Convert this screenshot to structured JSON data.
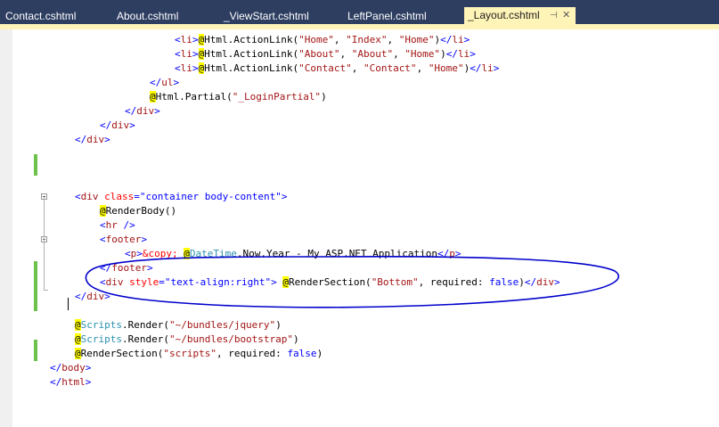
{
  "tabs": [
    {
      "label": "Contact.cshtml"
    },
    {
      "label": "About.cshtml"
    },
    {
      "label": "_ViewStart.cshtml"
    },
    {
      "label": "LeftPanel.cshtml"
    },
    {
      "label": "_Layout.cshtml",
      "active": true
    }
  ],
  "icons": {
    "pin": "pin-icon",
    "close": "close-icon",
    "fold": "fold-collapse-icon"
  },
  "colors": {
    "tabbar": "#2d3e61",
    "active_tab": "#fff4b8",
    "change_mark": "#6cc24a",
    "annotation": "#0000cc",
    "razor_at": "#ffff00"
  },
  "code_lines": [
    [
      {
        "t": "<",
        "c": "br"
      },
      {
        "t": "li",
        "c": "tag"
      },
      {
        "t": ">",
        "c": "br"
      },
      {
        "t": "@",
        "c": "at"
      },
      {
        "t": "Html.ActionLink(",
        "c": "txt"
      },
      {
        "t": "\"Home\"",
        "c": "str"
      },
      {
        "t": ", ",
        "c": "txt"
      },
      {
        "t": "\"Index\"",
        "c": "str"
      },
      {
        "t": ", ",
        "c": "txt"
      },
      {
        "t": "\"Home\"",
        "c": "str"
      },
      {
        "t": ")",
        "c": "txt"
      },
      {
        "t": "</",
        "c": "br"
      },
      {
        "t": "li",
        "c": "tag"
      },
      {
        "t": ">",
        "c": "br"
      }
    ],
    [
      {
        "t": "<",
        "c": "br"
      },
      {
        "t": "li",
        "c": "tag"
      },
      {
        "t": ">",
        "c": "br"
      },
      {
        "t": "@",
        "c": "at"
      },
      {
        "t": "Html.ActionLink(",
        "c": "txt"
      },
      {
        "t": "\"About\"",
        "c": "str"
      },
      {
        "t": ", ",
        "c": "txt"
      },
      {
        "t": "\"About\"",
        "c": "str"
      },
      {
        "t": ", ",
        "c": "txt"
      },
      {
        "t": "\"Home\"",
        "c": "str"
      },
      {
        "t": ")",
        "c": "txt"
      },
      {
        "t": "</",
        "c": "br"
      },
      {
        "t": "li",
        "c": "tag"
      },
      {
        "t": ">",
        "c": "br"
      }
    ],
    [
      {
        "t": "<",
        "c": "br"
      },
      {
        "t": "li",
        "c": "tag"
      },
      {
        "t": ">",
        "c": "br"
      },
      {
        "t": "@",
        "c": "at"
      },
      {
        "t": "Html.ActionLink(",
        "c": "txt"
      },
      {
        "t": "\"Contact\"",
        "c": "str"
      },
      {
        "t": ", ",
        "c": "txt"
      },
      {
        "t": "\"Contact\"",
        "c": "str"
      },
      {
        "t": ", ",
        "c": "txt"
      },
      {
        "t": "\"Home\"",
        "c": "str"
      },
      {
        "t": ")",
        "c": "txt"
      },
      {
        "t": "</",
        "c": "br"
      },
      {
        "t": "li",
        "c": "tag"
      },
      {
        "t": ">",
        "c": "br"
      }
    ],
    [
      {
        "t": "</",
        "c": "br"
      },
      {
        "t": "ul",
        "c": "tag"
      },
      {
        "t": ">",
        "c": "br"
      }
    ],
    [
      {
        "t": "@",
        "c": "at"
      },
      {
        "t": "Html.Partial(",
        "c": "txt"
      },
      {
        "t": "\"_LoginPartial\"",
        "c": "str"
      },
      {
        "t": ")",
        "c": "txt"
      }
    ],
    [
      {
        "t": "</",
        "c": "br"
      },
      {
        "t": "div",
        "c": "tag"
      },
      {
        "t": ">",
        "c": "br"
      }
    ],
    [
      {
        "t": "</",
        "c": "br"
      },
      {
        "t": "div",
        "c": "tag"
      },
      {
        "t": ">",
        "c": "br"
      }
    ],
    [
      {
        "t": "</",
        "c": "br"
      },
      {
        "t": "div",
        "c": "tag"
      },
      {
        "t": ">",
        "c": "br"
      }
    ],
    [],
    [],
    [],
    [],
    [
      {
        "t": "<",
        "c": "br"
      },
      {
        "t": "div",
        "c": "tag"
      },
      {
        "t": " ",
        "c": "txt"
      },
      {
        "t": "class",
        "c": "attr"
      },
      {
        "t": "=",
        "c": "br"
      },
      {
        "t": "\"container body-content\"",
        "c": "br"
      },
      {
        "t": ">",
        "c": "br"
      }
    ],
    [
      {
        "t": "@",
        "c": "at"
      },
      {
        "t": "RenderBody()",
        "c": "txt"
      }
    ],
    [
      {
        "t": "<",
        "c": "br"
      },
      {
        "t": "hr",
        "c": "tag"
      },
      {
        "t": " />",
        "c": "br"
      }
    ],
    [
      {
        "t": "<",
        "c": "br"
      },
      {
        "t": "footer",
        "c": "tag"
      },
      {
        "t": ">",
        "c": "br"
      }
    ],
    [
      {
        "t": "<",
        "c": "br"
      },
      {
        "t": "p",
        "c": "tag"
      },
      {
        "t": ">",
        "c": "br"
      },
      {
        "t": "&copy;",
        "c": "ent"
      },
      {
        "t": " ",
        "c": "txt"
      },
      {
        "t": "@",
        "c": "at"
      },
      {
        "t": "DateTime",
        "c": "type"
      },
      {
        "t": ".Now.Year - My ASP.NET Application",
        "c": "txt"
      },
      {
        "t": "</",
        "c": "br"
      },
      {
        "t": "p",
        "c": "tag"
      },
      {
        "t": ">",
        "c": "br"
      }
    ],
    [
      {
        "t": "</",
        "c": "br"
      },
      {
        "t": "footer",
        "c": "tag"
      },
      {
        "t": ">",
        "c": "br"
      }
    ],
    [
      {
        "t": "<",
        "c": "br"
      },
      {
        "t": "div",
        "c": "tag"
      },
      {
        "t": " ",
        "c": "txt"
      },
      {
        "t": "style",
        "c": "attr"
      },
      {
        "t": "=",
        "c": "br"
      },
      {
        "t": "\"text-align:right\"",
        "c": "br"
      },
      {
        "t": ">",
        "c": "br"
      },
      {
        "t": " ",
        "c": "txt"
      },
      {
        "t": "@",
        "c": "at"
      },
      {
        "t": "RenderSection(",
        "c": "txt"
      },
      {
        "t": "\"Bottom\"",
        "c": "str"
      },
      {
        "t": ", required: ",
        "c": "txt"
      },
      {
        "t": "false",
        "c": "kw"
      },
      {
        "t": ")",
        "c": "txt"
      },
      {
        "t": "</",
        "c": "br"
      },
      {
        "t": "div",
        "c": "tag"
      },
      {
        "t": ">",
        "c": "br"
      }
    ],
    [
      {
        "t": "</",
        "c": "br"
      },
      {
        "t": "div",
        "c": "tag"
      },
      {
        "t": ">",
        "c": "br"
      }
    ],
    [],
    [
      {
        "t": "@",
        "c": "at"
      },
      {
        "t": "Scripts",
        "c": "type"
      },
      {
        "t": ".Render(",
        "c": "txt"
      },
      {
        "t": "\"~/bundles/jquery\"",
        "c": "str"
      },
      {
        "t": ")",
        "c": "txt"
      }
    ],
    [
      {
        "t": "@",
        "c": "at"
      },
      {
        "t": "Scripts",
        "c": "type"
      },
      {
        "t": ".Render(",
        "c": "txt"
      },
      {
        "t": "\"~/bundles/bootstrap\"",
        "c": "str"
      },
      {
        "t": ")",
        "c": "txt"
      }
    ],
    [
      {
        "t": "@",
        "c": "at"
      },
      {
        "t": "RenderSection(",
        "c": "txt"
      },
      {
        "t": "\"scripts\"",
        "c": "str"
      },
      {
        "t": ", required: ",
        "c": "txt"
      },
      {
        "t": "false",
        "c": "kw"
      },
      {
        "t": ")",
        "c": "txt"
      }
    ],
    [
      {
        "t": "</",
        "c": "br"
      },
      {
        "t": "body",
        "c": "tag"
      },
      {
        "t": ">",
        "c": "br"
      }
    ],
    [
      {
        "t": "</",
        "c": "br"
      },
      {
        "t": "html",
        "c": "tag"
      },
      {
        "t": ">",
        "c": "br"
      }
    ]
  ]
}
